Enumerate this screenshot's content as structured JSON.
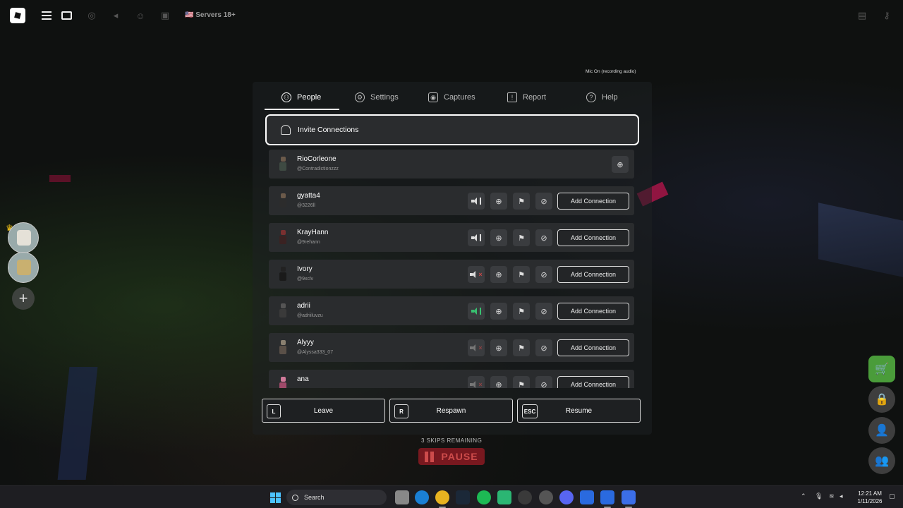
{
  "topbar": {
    "servers_label": "🇺🇸 Servers 18+",
    "mic_status": "Mic On (recording audio)"
  },
  "tabs": [
    {
      "label": "People",
      "icon": "people-icon",
      "active": true
    },
    {
      "label": "Settings",
      "icon": "gear-icon",
      "active": false
    },
    {
      "label": "Captures",
      "icon": "camera-icon",
      "active": false
    },
    {
      "label": "Report",
      "icon": "flag-icon",
      "active": false
    },
    {
      "label": "Help",
      "icon": "help-icon",
      "active": false
    }
  ],
  "invite": {
    "label": "Invite Connections"
  },
  "players": [
    {
      "name": "RioCorleone",
      "username": "@Contradictionzzz",
      "self": true
    },
    {
      "name": "gyatta4",
      "username": "@3226ll",
      "voice": "speaking",
      "add_label": "Add Connection"
    },
    {
      "name": "KrayHann",
      "username": "@9rehann",
      "voice": "speaking",
      "add_label": "Add Connection"
    },
    {
      "name": "Ivory",
      "username": "@9xclv",
      "voice": "muted",
      "add_label": "Add Connection"
    },
    {
      "name": "adrii",
      "username": "@adriiluvzu",
      "voice": "active-green",
      "add_label": "Add Connection"
    },
    {
      "name": "Alyyy",
      "username": "@Alyssa333_07",
      "voice": "muted-faded",
      "add_label": "Add Connection"
    },
    {
      "name": "ana",
      "username": "",
      "voice": "muted-faded",
      "add_label": "Add Connection"
    }
  ],
  "bottom_buttons": [
    {
      "key": "L",
      "label": "Leave"
    },
    {
      "key": "R",
      "label": "Respawn"
    },
    {
      "key": "ESC",
      "label": "Resume"
    }
  ],
  "skips": "3 SKIPS REMAINING",
  "pause_label": "PAUSE",
  "taskbar": {
    "search_placeholder": "Search",
    "time": "12:21 AM",
    "date": "1/11/2026",
    "discord_badge": "99"
  },
  "colors": {
    "cart_green": "#4a9c3a",
    "pause_red": "#8a1a22",
    "voice_green": "#38c070",
    "mute_red": "#c54545"
  }
}
